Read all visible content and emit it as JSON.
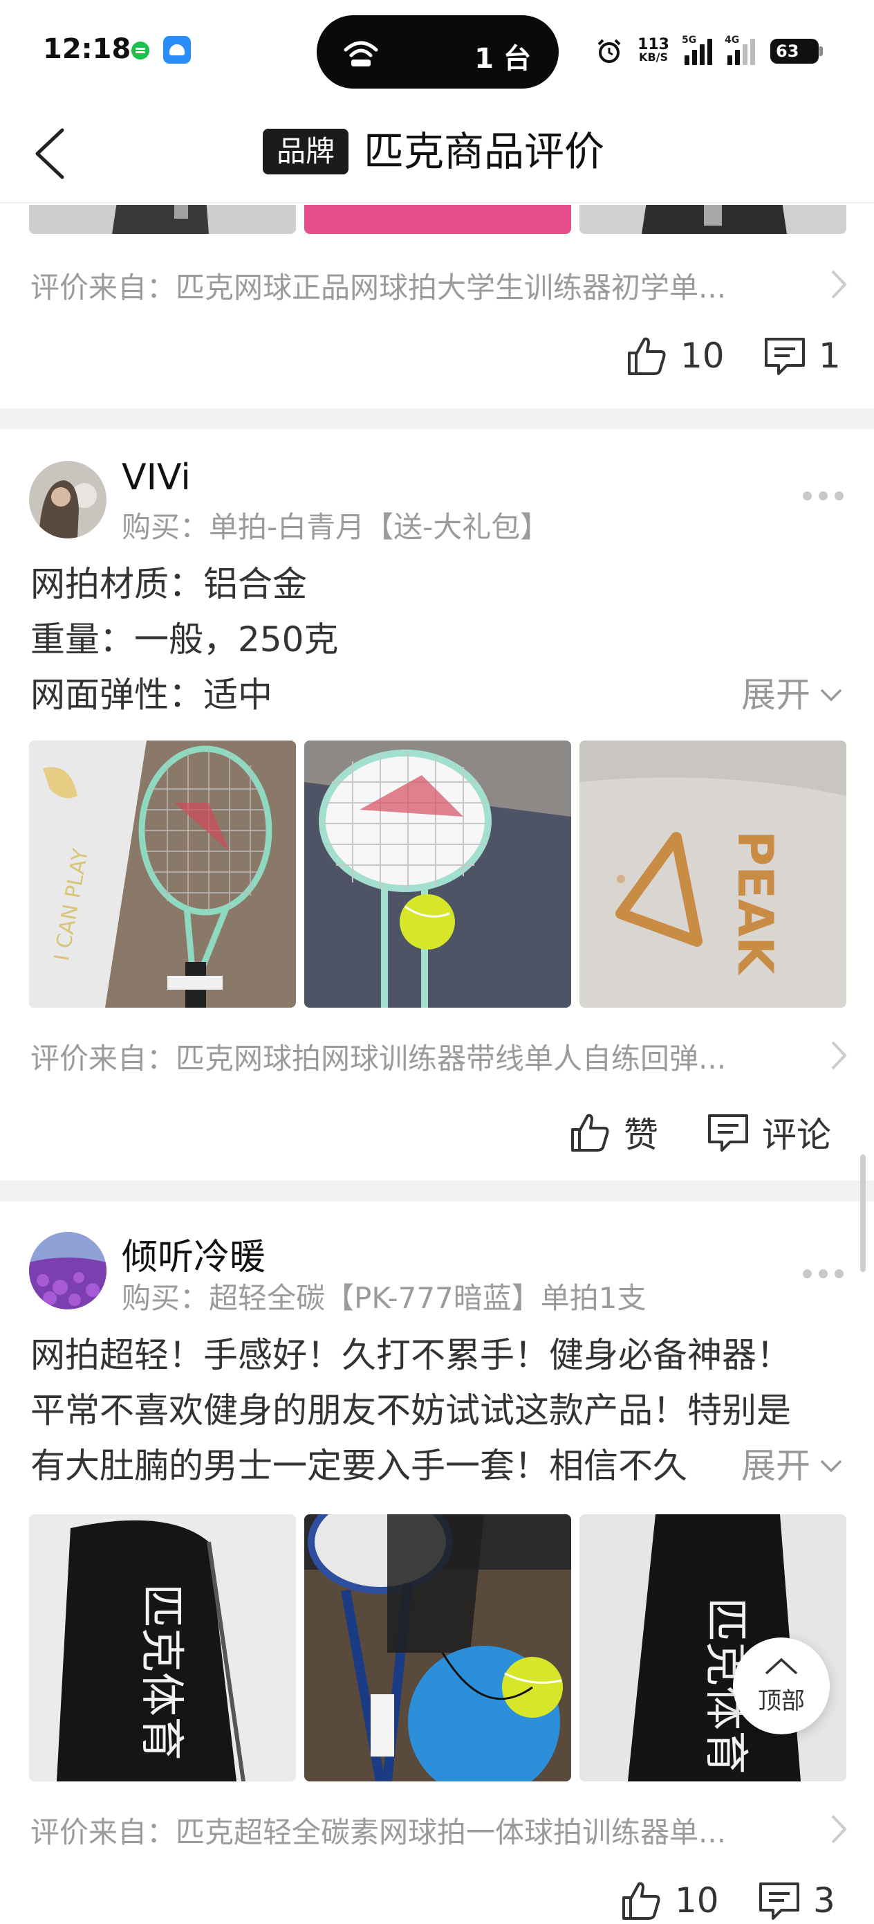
{
  "status_bar": {
    "time": "12:18",
    "island_text": "1 台",
    "net_speed_value": "113",
    "net_speed_unit": "KB/S",
    "sim1_label": "5G",
    "sim2_label": "4G",
    "battery": "63",
    "icons": [
      "messaging-app-icon",
      "android-app-icon",
      "hotspot-icon",
      "alarm-icon",
      "signal-icon",
      "battery-icon"
    ]
  },
  "header": {
    "badge": "品牌",
    "title": "匹克商品评价"
  },
  "reviews": [
    {
      "source": "评价来自：匹克网球正品网球拍大学生训练器初学单...",
      "like_count": "10",
      "comment_count": "1"
    },
    {
      "username": "VIVi",
      "purchase": "购买：单拍-白青月【送-大礼包】",
      "lines": [
        "网拍材质：铝合金",
        "重量：一般，250克",
        "网面弹性：适中"
      ],
      "expand_label": "展开",
      "source": "评价来自：匹克网球拍网球训练器带线单人自练回弹...",
      "like_label": "赞",
      "comment_label": "评论"
    },
    {
      "username": "倾听冷暖",
      "purchase": "购买：超轻全碳【PK-777暗蓝】单拍1支",
      "lines": [
        "网拍超轻！手感好！久打不累手！健身必备神器！",
        "平常不喜欢健身的朋友不妨试试这款产品！特别是",
        "有大肚腩的男士一定要入手一套！相信不久"
      ],
      "expand_label": "展开",
      "source": "评价来自：匹克超轻全碳素网球拍一体球拍训练器单...",
      "like_count": "10",
      "comment_count": "3"
    }
  ],
  "top_button": {
    "label": "顶部"
  },
  "colors": {
    "accent_text": "#333333",
    "muted": "#9b9b9b",
    "separator": "#f2f2f2",
    "ball": "#d8e62a",
    "racket_mint": "#9fdcc8"
  }
}
